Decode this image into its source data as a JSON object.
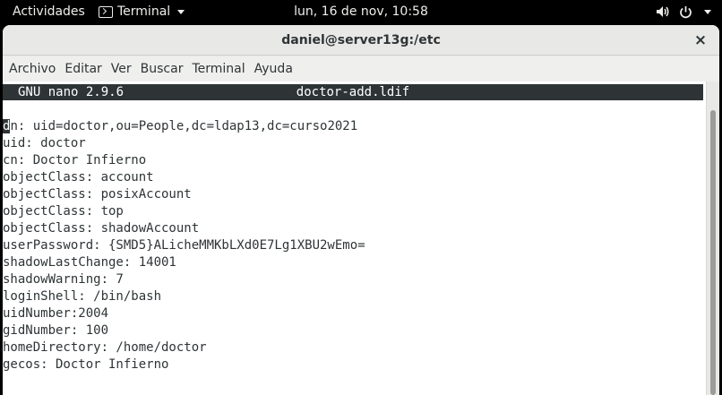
{
  "topbar": {
    "activities": "Actividades",
    "app_name": "Terminal",
    "clock": "lun, 16 de nov, 10:58"
  },
  "window": {
    "title": "daniel@server13g:/etc",
    "close_glyph": "×"
  },
  "menu": [
    "Archivo",
    "Editar",
    "Ver",
    "Buscar",
    "Terminal",
    "Ayuda"
  ],
  "nano": {
    "version": "GNU nano 2.9.6",
    "filename": "doctor-add.ldif"
  },
  "file": {
    "first_char": "d",
    "first_rest": "n: uid=doctor,ou=People,dc=ldap13,dc=curso2021",
    "lines": [
      "uid: doctor",
      "cn: Doctor Infierno",
      "objectClass: account",
      "objectClass: posixAccount",
      "objectClass: top",
      "objectClass: shadowAccount",
      "userPassword: {SMD5}ALicheMMKbLXd0E7Lg1XBU2wEmo=",
      "shadowLastChange: 14001",
      "shadowWarning: 7",
      "loginShell: /bin/bash",
      "uidNumber:2004",
      "gidNumber: 100",
      "homeDirectory: /home/doctor",
      "gecos: Doctor Infierno"
    ]
  },
  "icons": {
    "app": "terminal-icon",
    "volume": "volume-icon",
    "power": "power-icon"
  }
}
